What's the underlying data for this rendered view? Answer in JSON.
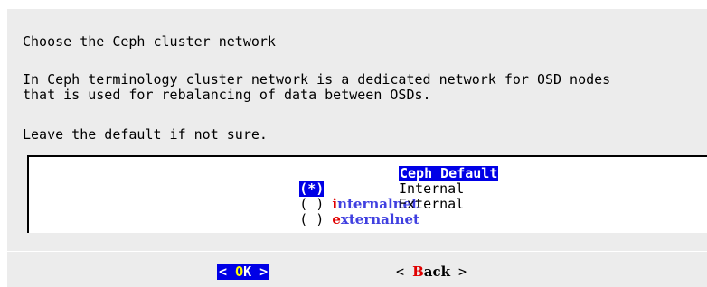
{
  "dialog": {
    "heading": "Choose the Ceph cluster network",
    "description_line1": "In Ceph terminology cluster network is a dedicated network for OSD nodes",
    "description_line2": "that is used for rebalancing of data between OSDs.",
    "hint": "Leave the default if not sure."
  },
  "options": [
    {
      "mark": "(*)",
      "tag_first": "",
      "tag_rest": "",
      "label": "Ceph Default",
      "selected": true
    },
    {
      "mark": "( )",
      "tag_first": "i",
      "tag_rest": "nternalnet",
      "label": "Internal",
      "selected": false
    },
    {
      "mark": "( )",
      "tag_first": "e",
      "tag_rest": "xternalnet",
      "label": "External",
      "selected": false
    }
  ],
  "buttons": {
    "ok": {
      "left": "< ",
      "hot": "O",
      "rest": "K",
      "right": " >"
    },
    "back": {
      "left": "< ",
      "hot": "B",
      "rest": "ack",
      "right": " >"
    }
  },
  "colors": {
    "highlight": "#0000e6",
    "hotkey_text": "#e00000",
    "tag_text": "#4040e0",
    "dialog_background": "#ececec"
  }
}
